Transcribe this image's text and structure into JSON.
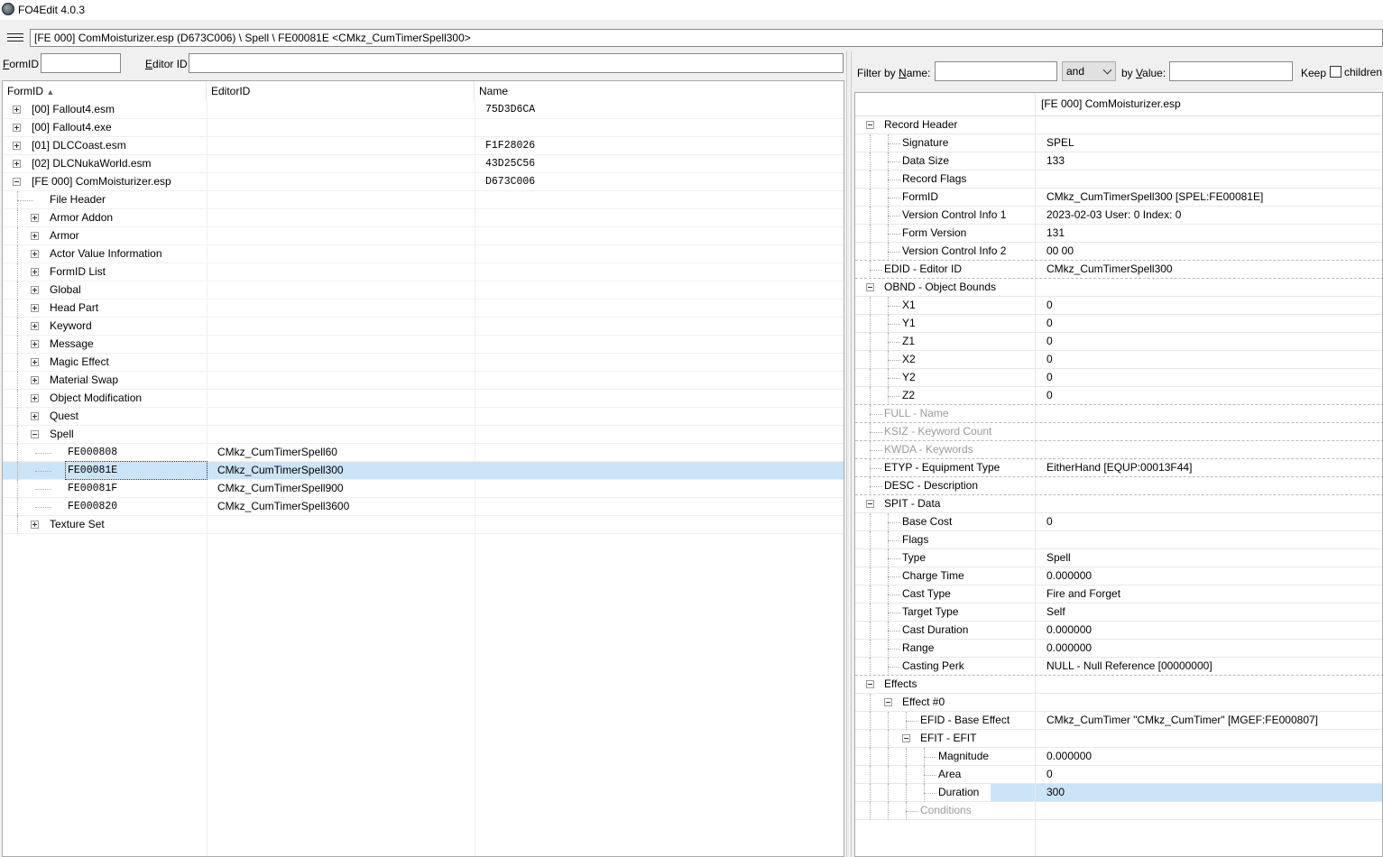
{
  "window": {
    "title": "FO4Edit 4.0.3"
  },
  "path": {
    "text": "[FE 000] ComMoisturizer.esp (D673C006) \\ Spell \\ FE00081E <CMkz_CumTimerSpell300>"
  },
  "search": {
    "formid_label": "FormID",
    "formid_value": "",
    "editorid_label": "Editor ID",
    "editorid_value": ""
  },
  "left_grid": {
    "columns": [
      "FormID",
      "EditorID",
      "Name"
    ],
    "rows": [
      {
        "formid": "[00] Fallout4.esm",
        "editorid": "",
        "name": "75D3D6CA",
        "indent": 0,
        "exp": "plus"
      },
      {
        "formid": "[00] Fallout4.exe",
        "editorid": "",
        "name": "",
        "indent": 0,
        "exp": "plus"
      },
      {
        "formid": "[01] DLCCoast.esm",
        "editorid": "",
        "name": "F1F28026",
        "indent": 0,
        "exp": "plus"
      },
      {
        "formid": "[02] DLCNukaWorld.esm",
        "editorid": "",
        "name": "43D25C56",
        "indent": 0,
        "exp": "plus"
      },
      {
        "formid": "[FE 000] ComMoisturizer.esp",
        "editorid": "",
        "name": "D673C006",
        "indent": 0,
        "exp": "minus"
      },
      {
        "formid": "File Header",
        "editorid": "",
        "name": "",
        "indent": 1,
        "exp": "none"
      },
      {
        "formid": "Armor Addon",
        "editorid": "",
        "name": "",
        "indent": 1,
        "exp": "plus"
      },
      {
        "formid": "Armor",
        "editorid": "",
        "name": "",
        "indent": 1,
        "exp": "plus"
      },
      {
        "formid": "Actor Value Information",
        "editorid": "",
        "name": "",
        "indent": 1,
        "exp": "plus"
      },
      {
        "formid": "FormID List",
        "editorid": "",
        "name": "",
        "indent": 1,
        "exp": "plus"
      },
      {
        "formid": "Global",
        "editorid": "",
        "name": "",
        "indent": 1,
        "exp": "plus"
      },
      {
        "formid": "Head Part",
        "editorid": "",
        "name": "",
        "indent": 1,
        "exp": "plus"
      },
      {
        "formid": "Keyword",
        "editorid": "",
        "name": "",
        "indent": 1,
        "exp": "plus"
      },
      {
        "formid": "Message",
        "editorid": "",
        "name": "",
        "indent": 1,
        "exp": "plus"
      },
      {
        "formid": "Magic Effect",
        "editorid": "",
        "name": "",
        "indent": 1,
        "exp": "plus"
      },
      {
        "formid": "Material Swap",
        "editorid": "",
        "name": "",
        "indent": 1,
        "exp": "plus"
      },
      {
        "formid": "Object Modification",
        "editorid": "",
        "name": "",
        "indent": 1,
        "exp": "plus"
      },
      {
        "formid": "Quest",
        "editorid": "",
        "name": "",
        "indent": 1,
        "exp": "plus"
      },
      {
        "formid": "Spell",
        "editorid": "",
        "name": "",
        "indent": 1,
        "exp": "minus"
      },
      {
        "formid": "FE000808",
        "editorid": "CMkz_CumTimerSpell60",
        "name": "",
        "indent": 2,
        "exp": "none"
      },
      {
        "formid": "FE00081E",
        "editorid": "CMkz_CumTimerSpell300",
        "name": "",
        "indent": 2,
        "exp": "none",
        "selected": true
      },
      {
        "formid": "FE00081F",
        "editorid": "CMkz_CumTimerSpell900",
        "name": "",
        "indent": 2,
        "exp": "none"
      },
      {
        "formid": "FE000820",
        "editorid": "CMkz_CumTimerSpell3600",
        "name": "",
        "indent": 2,
        "exp": "none"
      },
      {
        "formid": "Texture Set",
        "editorid": "",
        "name": "",
        "indent": 1,
        "exp": "plus"
      }
    ]
  },
  "filter": {
    "name_label": "Filter by Name:",
    "name_value": "",
    "op_value": "and",
    "value_label": "by Value:",
    "value_value": "",
    "keep_label": "Keep",
    "children_label": "children"
  },
  "right_grid": {
    "header_value": "[FE 000] ComMoisturizer.esp",
    "rows": [
      {
        "key": "Record Header",
        "value": "",
        "level": 0,
        "exp": "minus"
      },
      {
        "key": "Signature",
        "value": "SPEL",
        "level": 1
      },
      {
        "key": "Data Size",
        "value": "133",
        "level": 1
      },
      {
        "key": "Record Flags",
        "value": "",
        "level": 1
      },
      {
        "key": "FormID",
        "value": "CMkz_CumTimerSpell300 [SPEL:FE00081E]",
        "level": 1
      },
      {
        "key": "Version Control Info 1",
        "value": "2023-02-03 User: 0 Index: 0",
        "level": 1
      },
      {
        "key": "Form Version",
        "value": "131",
        "level": 1
      },
      {
        "key": "Version Control Info 2",
        "value": "00 00",
        "level": 1,
        "sep": true
      },
      {
        "key": "EDID - Editor ID",
        "value": "CMkz_CumTimerSpell300",
        "level": 0,
        "sep": true
      },
      {
        "key": "OBND - Object Bounds",
        "value": "",
        "level": 0,
        "exp": "minus"
      },
      {
        "key": "X1",
        "value": "0",
        "level": 1
      },
      {
        "key": "Y1",
        "value": "0",
        "level": 1
      },
      {
        "key": "Z1",
        "value": "0",
        "level": 1
      },
      {
        "key": "X2",
        "value": "0",
        "level": 1
      },
      {
        "key": "Y2",
        "value": "0",
        "level": 1
      },
      {
        "key": "Z2",
        "value": "0",
        "level": 1,
        "sep": true
      },
      {
        "key": "FULL - Name",
        "value": "",
        "level": 0,
        "grey": true,
        "sep": true
      },
      {
        "key": "KSIZ - Keyword Count",
        "value": "",
        "level": 0,
        "grey": true,
        "sep": true
      },
      {
        "key": "KWDA - Keywords",
        "value": "",
        "level": 0,
        "grey": true,
        "sep": true
      },
      {
        "key": "ETYP - Equipment Type",
        "value": "EitherHand [EQUP:00013F44]",
        "level": 0,
        "sep": true
      },
      {
        "key": "DESC - Description",
        "value": "",
        "level": 0,
        "sep": true
      },
      {
        "key": "SPIT - Data",
        "value": "",
        "level": 0,
        "exp": "minus"
      },
      {
        "key": "Base Cost",
        "value": "0",
        "level": 1
      },
      {
        "key": "Flags",
        "value": "",
        "level": 1
      },
      {
        "key": "Type",
        "value": "Spell",
        "level": 1
      },
      {
        "key": "Charge Time",
        "value": "0.000000",
        "level": 1
      },
      {
        "key": "Cast Type",
        "value": "Fire and Forget",
        "level": 1
      },
      {
        "key": "Target Type",
        "value": "Self",
        "level": 1
      },
      {
        "key": "Cast Duration",
        "value": "0.000000",
        "level": 1
      },
      {
        "key": "Range",
        "value": "0.000000",
        "level": 1
      },
      {
        "key": "Casting Perk",
        "value": "NULL - Null Reference [00000000]",
        "level": 1,
        "sep": true
      },
      {
        "key": "Effects",
        "value": "",
        "level": 0,
        "exp": "minus"
      },
      {
        "key": "Effect #0",
        "value": "",
        "level": 1,
        "exp": "minus"
      },
      {
        "key": "EFID - Base Effect",
        "value": "CMkz_CumTimer \"CMkz_CumTimer\" [MGEF:FE000807]",
        "level": 2
      },
      {
        "key": "EFIT - EFIT",
        "value": "",
        "level": 2,
        "exp": "minus"
      },
      {
        "key": "Magnitude",
        "value": "0.000000",
        "level": 3
      },
      {
        "key": "Area",
        "value": "0",
        "level": 3
      },
      {
        "key": "Duration",
        "value": "300",
        "level": 3,
        "selected": true
      },
      {
        "key": "Conditions",
        "value": "",
        "level": 2,
        "grey": true
      }
    ]
  }
}
